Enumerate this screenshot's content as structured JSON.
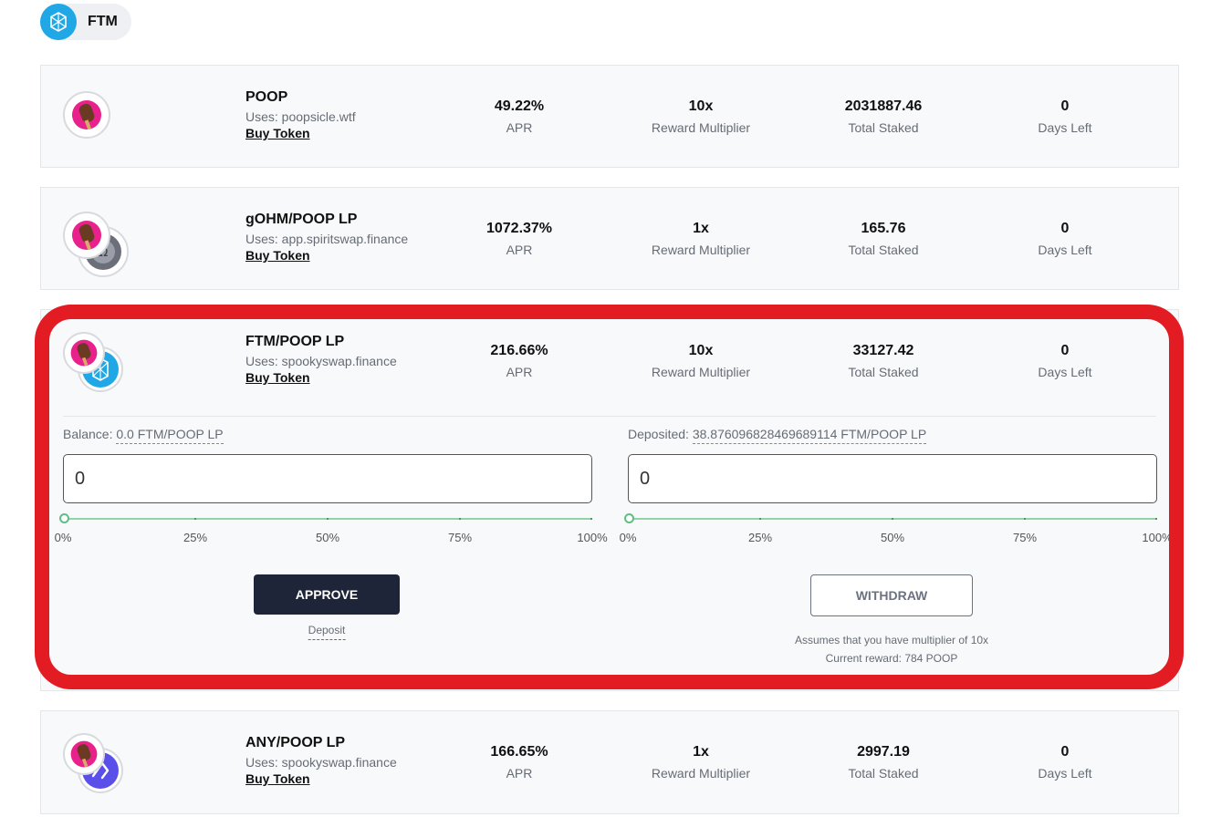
{
  "chain_tab": {
    "label": "FTM",
    "icon": "fantom-icon",
    "color": "#1fa7e6"
  },
  "pools": [
    {
      "name": "POOP",
      "uses": "Uses: poopsicle.wtf",
      "buy_label": "Buy Token",
      "apr": "49.22%",
      "apr_label": "APR",
      "multiplier": "10x",
      "multiplier_label": "Reward Multiplier",
      "staked": "2031887.46",
      "staked_label": "Total Staked",
      "days": "0",
      "days_label": "Days Left",
      "icons": [
        "poopsicle-icon"
      ]
    },
    {
      "name": "gOHM/POOP LP",
      "uses": "Uses: app.spiritswap.finance",
      "buy_label": "Buy Token",
      "apr": "1072.37%",
      "apr_label": "APR",
      "multiplier": "1x",
      "multiplier_label": "Reward Multiplier",
      "staked": "165.76",
      "staked_label": "Total Staked",
      "days": "0",
      "days_label": "Days Left",
      "icons": [
        "poopsicle-icon",
        "gohm-icon"
      ]
    },
    {
      "name": "FTM/POOP LP",
      "uses": "Uses: spookyswap.finance",
      "buy_label": "Buy Token",
      "apr": "216.66%",
      "apr_label": "APR",
      "multiplier": "10x",
      "multiplier_label": "Reward Multiplier",
      "staked": "33127.42",
      "staked_label": "Total Staked",
      "days": "0",
      "days_label": "Days Left",
      "icons": [
        "poopsicle-icon",
        "fantom-icon"
      ]
    },
    {
      "name": "ANY/POOP LP",
      "uses": "Uses: spookyswap.finance",
      "buy_label": "Buy Token",
      "apr": "166.65%",
      "apr_label": "APR",
      "multiplier": "1x",
      "multiplier_label": "Reward Multiplier",
      "staked": "2997.19",
      "staked_label": "Total Staked",
      "days": "0",
      "days_label": "Days Left",
      "icons": [
        "poopsicle-icon",
        "anyswap-icon"
      ]
    }
  ],
  "expanded": {
    "balance_label": "Balance:",
    "balance_value": "0.0 FTM/POOP LP",
    "deposit_input_value": "0",
    "deposited_label": "Deposited:",
    "deposited_value": "38.87609682846968911​4 FTM/POOP LP",
    "withdraw_input_value": "0",
    "slider_ticks": [
      "0%",
      "25%",
      "50%",
      "75%",
      "100%"
    ],
    "deposit_slider_value": 0,
    "withdraw_slider_value": 0,
    "approve_label": "APPROVE",
    "deposit_link": "Deposit",
    "withdraw_label": "WITHDRAW",
    "note_multiplier": "Assumes that you have multiplier of 10x",
    "note_reward": "Current reward: 784 POOP"
  },
  "colors": {
    "highlight": "#e31b23",
    "approve_bg": "#1e2538",
    "slider": "#5fbf82"
  }
}
